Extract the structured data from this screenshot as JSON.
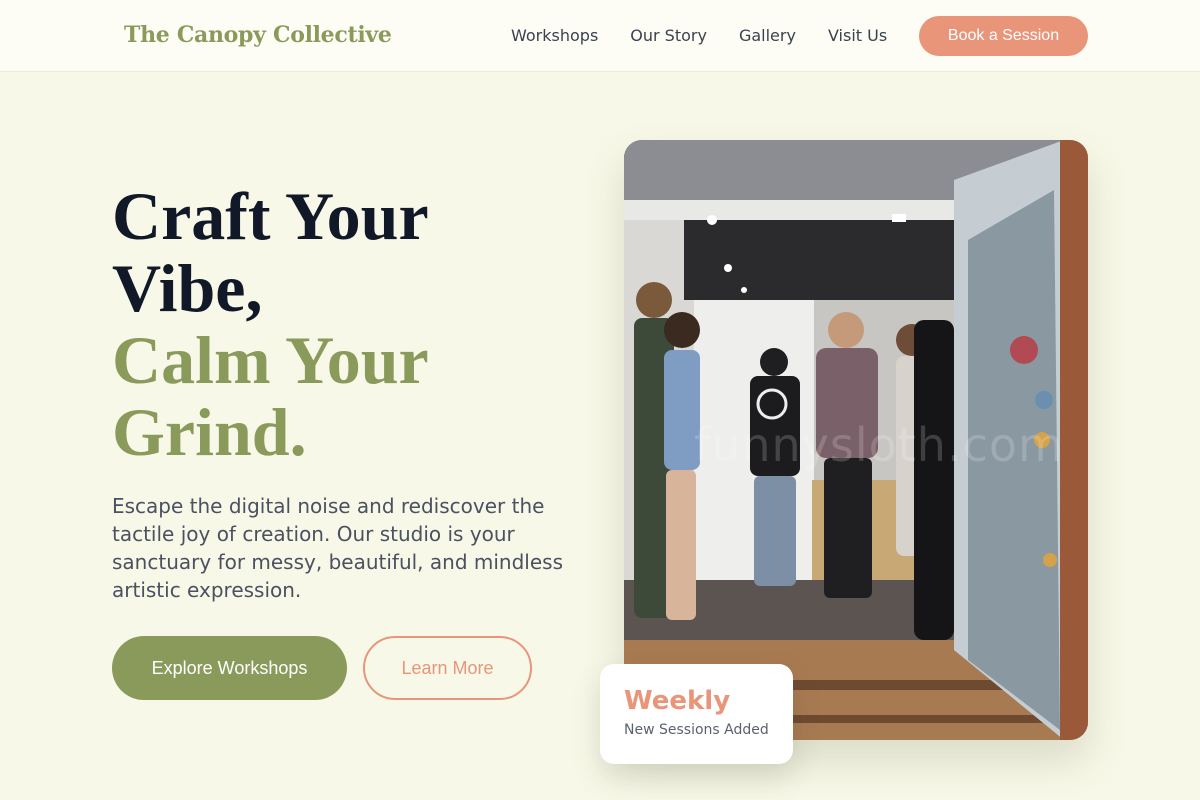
{
  "header": {
    "logo": "The Canopy Collective",
    "nav": [
      "Workshops",
      "Our Story",
      "Gallery",
      "Visit Us"
    ],
    "cta_label": "Book a Session"
  },
  "hero": {
    "title_line1": "Craft Your",
    "title_line2": "Vibe,",
    "title_line3": "Calm Your",
    "title_line4": "Grind.",
    "description": "Escape the digital noise and rediscover the tactile joy of creation. Our studio is your sanctuary for messy, beautiful, and mindless artistic expression.",
    "primary_button": "Explore Workshops",
    "secondary_button": "Learn More"
  },
  "photo": {
    "watermark": "funnysloth.com"
  },
  "badge": {
    "title": "Weekly",
    "subtitle": "New Sessions Added"
  },
  "colors": {
    "accent_green": "#8a9a5b",
    "accent_coral": "#e8957a",
    "background": "#f8f8e8"
  }
}
